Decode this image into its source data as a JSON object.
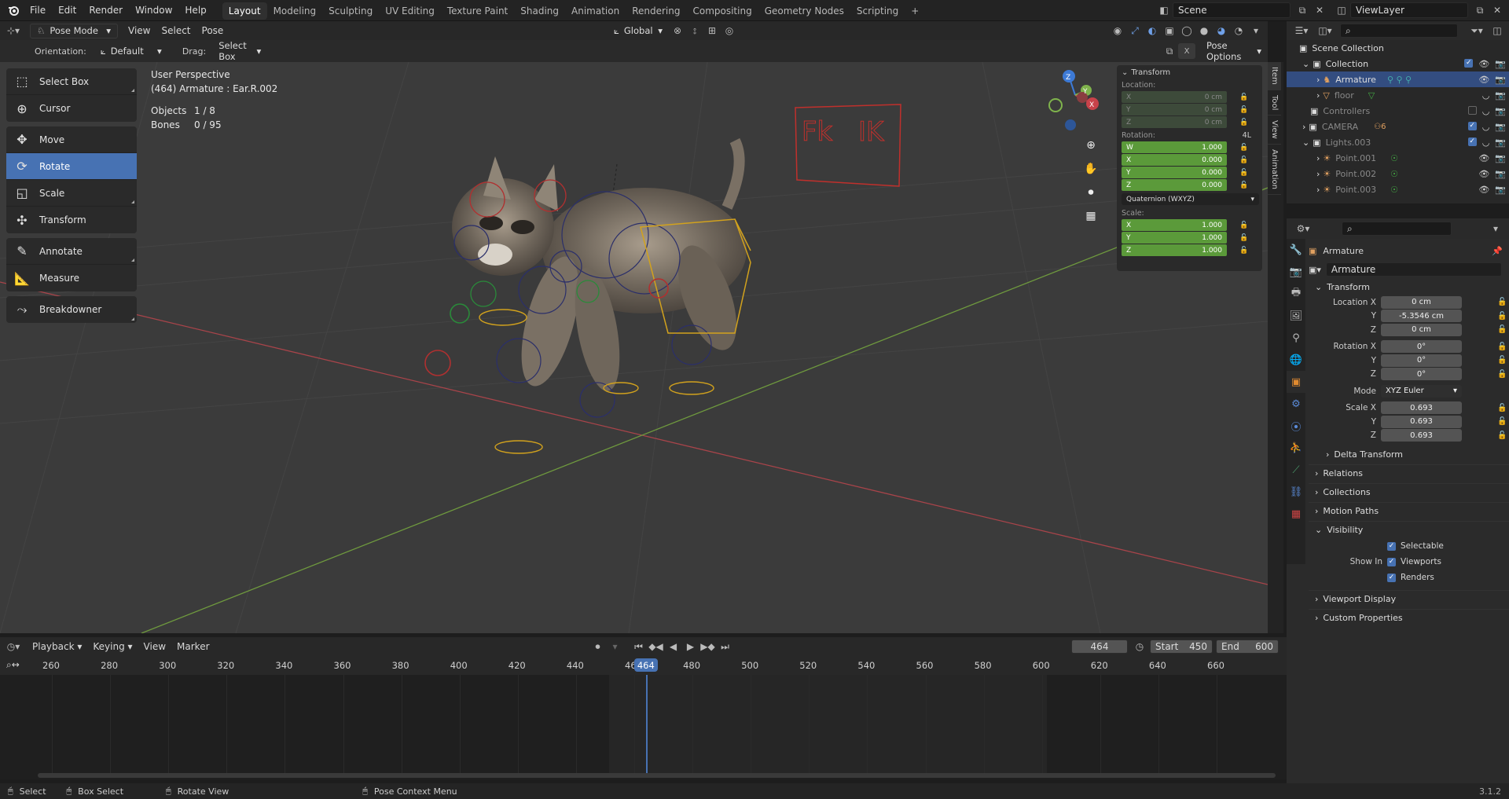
{
  "top_menu": [
    "File",
    "Edit",
    "Render",
    "Window",
    "Help"
  ],
  "workspaces": [
    "Layout",
    "Modeling",
    "Sculpting",
    "UV Editing",
    "Texture Paint",
    "Shading",
    "Animation",
    "Rendering",
    "Compositing",
    "Geometry Nodes",
    "Scripting"
  ],
  "active_workspace": "Layout",
  "scene_name": "Scene",
  "view_layer": "ViewLayer",
  "viewport_header": {
    "mode": "Pose Mode",
    "menus": [
      "View",
      "Select",
      "Pose"
    ],
    "transform_orientation": "Global"
  },
  "tool_settings": {
    "orientation_label": "Orientation:",
    "orientation_value": "Default",
    "drag_label": "Drag:",
    "drag_value": "Select Box",
    "pose_options": "Pose Options"
  },
  "tools": {
    "group1": [
      "Select Box",
      "Cursor"
    ],
    "group2": [
      "Move",
      "Rotate",
      "Scale",
      "Transform"
    ],
    "group3": [
      "Annotate",
      "Measure"
    ],
    "group4": [
      "Breakdowner"
    ],
    "active": "Rotate"
  },
  "viewport_info": {
    "line1": "User Perspective",
    "line2": "(464) Armature : Ear.R.002",
    "objects_label": "Objects",
    "objects_value": "1 / 8",
    "bones_label": "Bones",
    "bones_value": "0 / 95"
  },
  "viewport_overlay_text": [
    "Fk",
    "IK"
  ],
  "npanel": {
    "title": "Transform",
    "location_label": "Location:",
    "location": [
      {
        "axis": "X",
        "value": "0 cm"
      },
      {
        "axis": "Y",
        "value": "0 cm"
      },
      {
        "axis": "Z",
        "value": "0 cm"
      }
    ],
    "rotation_label": "Rotation:",
    "rotation_mode_short": "4L",
    "rotation": [
      {
        "axis": "W",
        "value": "1.000"
      },
      {
        "axis": "X",
        "value": "0.000"
      },
      {
        "axis": "Y",
        "value": "0.000"
      },
      {
        "axis": "Z",
        "value": "0.000"
      }
    ],
    "rotation_mode": "Quaternion (WXYZ)",
    "scale_label": "Scale:",
    "scale": [
      {
        "axis": "X",
        "value": "1.000"
      },
      {
        "axis": "Y",
        "value": "1.000"
      },
      {
        "axis": "Z",
        "value": "1.000"
      }
    ],
    "tabs": [
      "Item",
      "Tool",
      "View",
      "Animation"
    ]
  },
  "outliner": {
    "root": "Scene Collection",
    "rows": [
      {
        "name": "Collection",
        "level": 1
      },
      {
        "name": "Armature",
        "level": 2,
        "selected": true
      },
      {
        "name": "floor",
        "level": 2
      },
      {
        "name": "Controllers",
        "level": 1
      },
      {
        "name": "CAMERA",
        "level": 1,
        "badge": "6"
      },
      {
        "name": "Lights.003",
        "level": 1
      },
      {
        "name": "Point.001",
        "level": 2
      },
      {
        "name": "Point.002",
        "level": 2
      },
      {
        "name": "Point.003",
        "level": 2
      }
    ]
  },
  "properties": {
    "object_name": "Armature",
    "object_field": "Armature",
    "transform_title": "Transform",
    "location_x_label": "Location X",
    "location_x": "0 cm",
    "location_y_label": "Y",
    "location_y": "-5.3546 cm",
    "location_z_label": "Z",
    "location_z": "0 cm",
    "rotation_x_label": "Rotation X",
    "rotation_x": "0°",
    "rotation_y_label": "Y",
    "rotation_y": "0°",
    "rotation_z_label": "Z",
    "rotation_z": "0°",
    "mode_label": "Mode",
    "mode_value": "XYZ Euler",
    "scale_x_label": "Scale X",
    "scale_x": "0.693",
    "scale_y_label": "Y",
    "scale_y": "0.693",
    "scale_z_label": "Z",
    "scale_z": "0.693",
    "delta_transform": "Delta Transform",
    "sections": [
      "Relations",
      "Collections",
      "Motion Paths"
    ],
    "visibility": "Visibility",
    "selectable": "Selectable",
    "show_in": "Show In",
    "viewports": "Viewports",
    "renders": "Renders",
    "sections_after": [
      "Viewport Display",
      "Custom Properties"
    ]
  },
  "timeline": {
    "menus": [
      "Playback",
      "Keying",
      "View",
      "Marker"
    ],
    "current_frame": "464",
    "start_label": "Start",
    "start": "450",
    "end_label": "End",
    "end": "600",
    "ruler_ticks": [
      "260",
      "280",
      "300",
      "320",
      "340",
      "360",
      "380",
      "400",
      "420",
      "440",
      "46",
      "480",
      "500",
      "520",
      "540",
      "560",
      "580",
      "600",
      "620",
      "640",
      "660"
    ],
    "playhead": "464"
  },
  "statusbar": {
    "items": [
      "Select",
      "Box Select",
      "Rotate View",
      "Pose Context Menu"
    ],
    "version": "3.1.2"
  },
  "colors": {
    "accent": "#4772b3",
    "green_field": "#5b9a3a",
    "viewport_bg": "#3b3b3b",
    "x_axis": "#c8424a",
    "y_axis": "#7fb34c",
    "z_axis": "#3d7ad6"
  }
}
